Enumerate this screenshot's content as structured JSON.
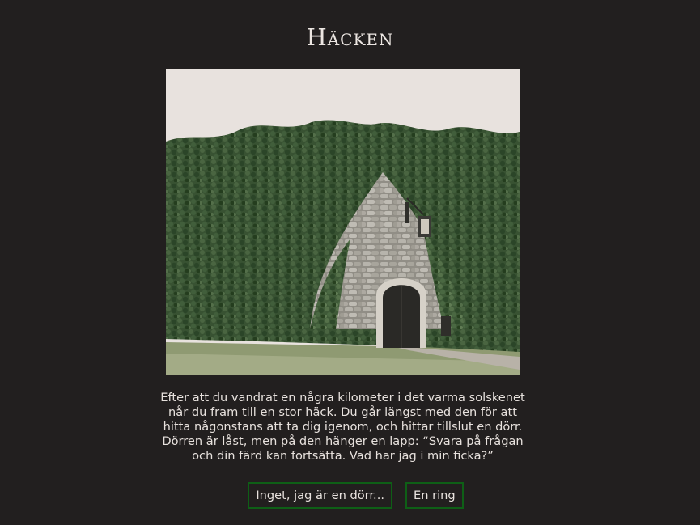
{
  "page": {
    "title": "Häcken",
    "image_alt": "Stenport i en murad vägg övervuxen av murgröna",
    "story": "Efter att du vandrat en några kilometer i det varma solskenet når du fram till en stor häck. Du går längst med den för att hitta någonstans att ta dig igenom, och hittar tillslut en dörr. Dörren är låst, men på den hänger en lapp: “Svara på frågan och din färd kan fortsätta. Vad har jag i min ficka?”"
  },
  "choices": [
    {
      "label": "Inget, jag är en dörr..."
    },
    {
      "label": "En ring"
    }
  ],
  "colors": {
    "background": "#221f1f",
    "text": "#e9e3df",
    "button_border": "#0e5f16"
  }
}
